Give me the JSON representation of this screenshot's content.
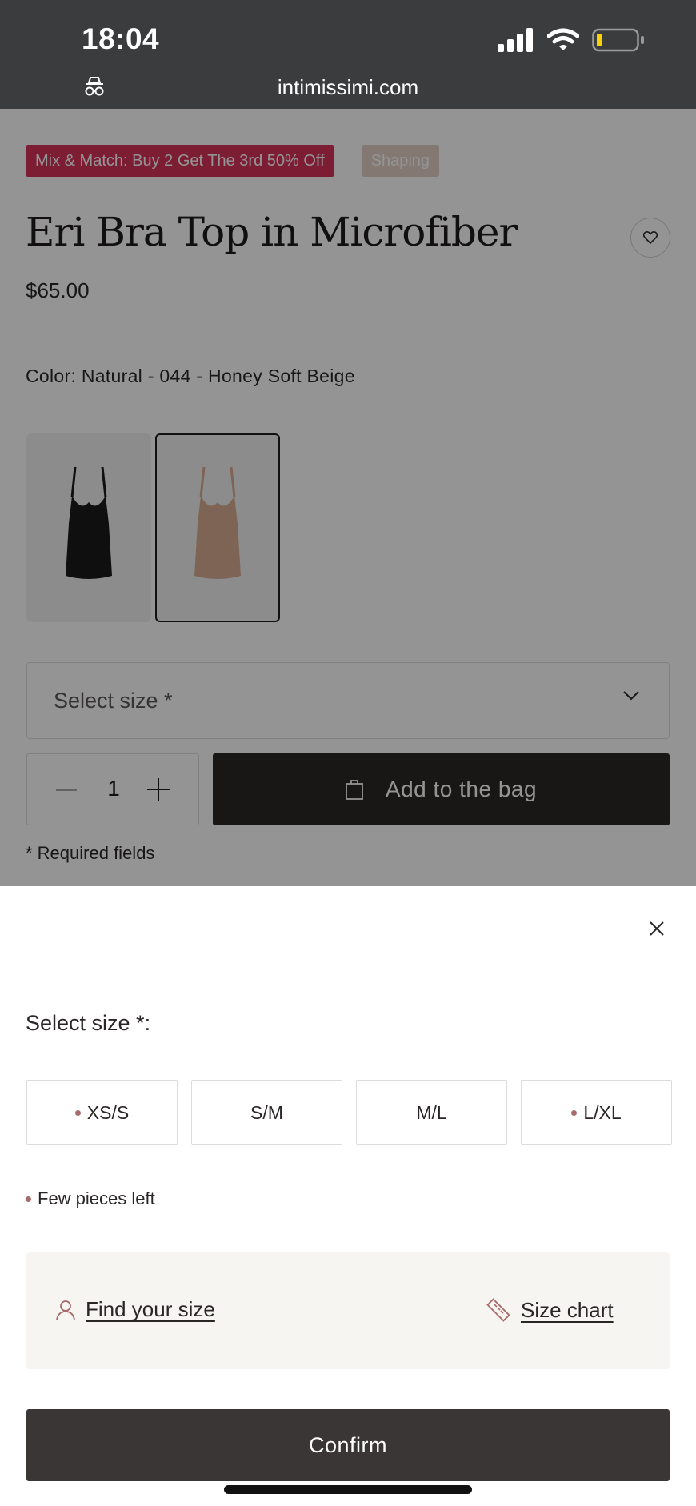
{
  "status_bar": {
    "time": "18:04"
  },
  "browser": {
    "url": "intimissimi.com"
  },
  "product": {
    "badges": [
      "Mix & Match: Buy 2 Get The 3rd 50% Off",
      "Shaping"
    ],
    "title": "Eri Bra Top in Microfiber",
    "price": "$65.00",
    "color_line": "Color: Natural - 044 - Honey Soft Beige",
    "swatches": [
      {
        "color": "#1a1a1a",
        "selected": false
      },
      {
        "color": "#d9ad93",
        "selected": true
      }
    ],
    "size_select_label": "Select size *",
    "quantity": "1",
    "add_to_bag": "Add to the bag",
    "required_note": "* Required fields"
  },
  "size_sheet": {
    "title": "Select size *:",
    "sizes": [
      {
        "label": "XS/S",
        "few_left": true
      },
      {
        "label": "S/M",
        "few_left": false
      },
      {
        "label": "M/L",
        "few_left": false
      },
      {
        "label": "L/XL",
        "few_left": true
      }
    ],
    "few_pieces_note": "Few pieces left",
    "find_your_size": "Find your size",
    "size_chart": "Size chart",
    "confirm": "Confirm"
  },
  "colors": {
    "promo_badge": "#d8335a",
    "primary_button": "#2b2626",
    "low_stock_dot": "#a66b6b"
  }
}
